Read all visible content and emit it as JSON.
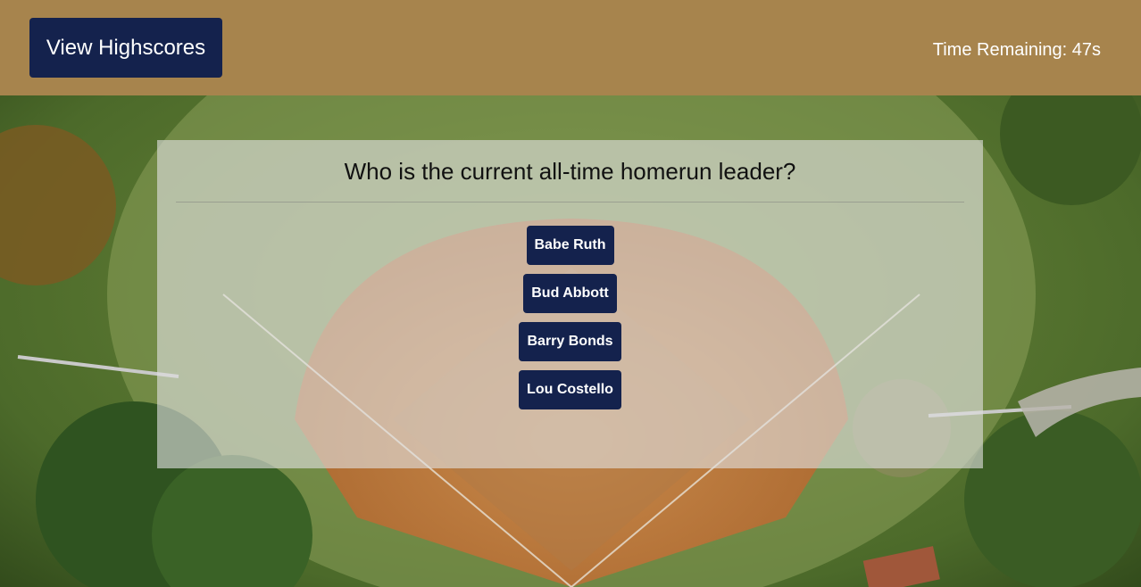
{
  "header": {
    "highscores_label": "View Highscores",
    "timer_text": "Time Remaining: 47s"
  },
  "quiz": {
    "question": "Who is the current all-time homerun leader?",
    "answers": [
      {
        "label": "Babe Ruth"
      },
      {
        "label": "Bud Abbott"
      },
      {
        "label": "Barry Bonds"
      },
      {
        "label": "Lou Costello"
      }
    ]
  },
  "colors": {
    "button_bg": "#14224d",
    "button_text": "#ffffff",
    "header_overlay": "#b0864e",
    "card_overlay": "#e1e1e1"
  },
  "background": {
    "scene": "aerial-baseball-field-photo"
  }
}
